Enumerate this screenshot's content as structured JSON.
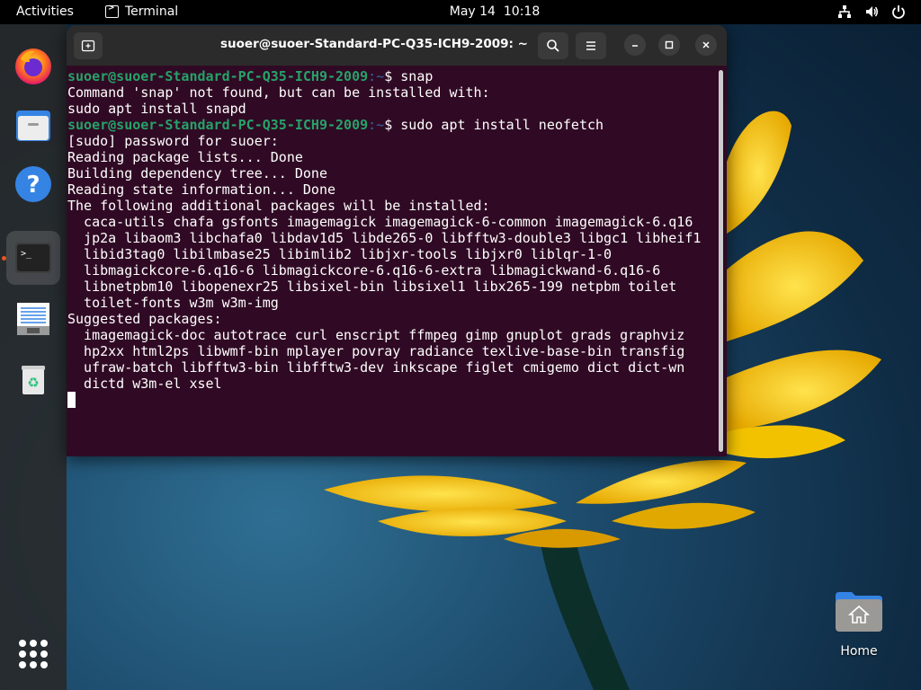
{
  "topbar": {
    "activities": "Activities",
    "app_name": "Terminal",
    "date": "May 14",
    "time": "10:18",
    "status_icons": [
      "network-icon",
      "volume-icon",
      "power-icon"
    ]
  },
  "dock": {
    "items": [
      {
        "name": "Firefox",
        "icon": "firefox-icon"
      },
      {
        "name": "Files",
        "icon": "files-icon"
      },
      {
        "name": "Help",
        "icon": "help-icon"
      },
      {
        "name": "Terminal",
        "icon": "terminal-icon",
        "active": true
      },
      {
        "name": "Text Editor",
        "icon": "text-editor-icon"
      },
      {
        "name": "Trash",
        "icon": "trash-icon"
      }
    ],
    "show_apps_icon": "apps-grid-icon"
  },
  "window": {
    "title": "suoer@suoer-Standard-PC-Q35-ICH9-2009: ~",
    "buttons": [
      "new-tab",
      "search",
      "menu",
      "minimize",
      "maximize",
      "close"
    ]
  },
  "terminal": {
    "prompt_user": "suoer@suoer-Standard-PC-Q35-ICH9-2009",
    "prompt_path": ":~",
    "lines": [
      {
        "type": "prompt",
        "cmd": "$ snap"
      },
      {
        "type": "out",
        "text": "Command 'snap' not found, but can be installed with:"
      },
      {
        "type": "out",
        "text": "sudo apt install snapd"
      },
      {
        "type": "prompt",
        "cmd": "$ sudo apt install neofetch"
      },
      {
        "type": "out",
        "text": "[sudo] password for suoer:"
      },
      {
        "type": "out",
        "text": "Reading package lists... Done"
      },
      {
        "type": "out",
        "text": "Building dependency tree... Done"
      },
      {
        "type": "out",
        "text": "Reading state information... Done"
      },
      {
        "type": "out",
        "text": "The following additional packages will be installed:"
      },
      {
        "type": "out",
        "text": "  caca-utils chafa gsfonts imagemagick imagemagick-6-common imagemagick-6.q16"
      },
      {
        "type": "out",
        "text": "  jp2a libaom3 libchafa0 libdav1d5 libde265-0 libfftw3-double3 libgc1 libheif1"
      },
      {
        "type": "out",
        "text": "  libid3tag0 libilmbase25 libimlib2 libjxr-tools libjxr0 liblqr-1-0"
      },
      {
        "type": "out",
        "text": "  libmagickcore-6.q16-6 libmagickcore-6.q16-6-extra libmagickwand-6.q16-6"
      },
      {
        "type": "out",
        "text": "  libnetpbm10 libopenexr25 libsixel-bin libsixel1 libx265-199 netpbm toilet"
      },
      {
        "type": "out",
        "text": "  toilet-fonts w3m w3m-img"
      },
      {
        "type": "out",
        "text": "Suggested packages:"
      },
      {
        "type": "out",
        "text": "  imagemagick-doc autotrace curl enscript ffmpeg gimp gnuplot grads graphviz"
      },
      {
        "type": "out",
        "text": "  hp2xx html2ps libwmf-bin mplayer povray radiance texlive-base-bin transfig"
      },
      {
        "type": "out",
        "text": "  ufraw-batch libfftw3-bin libfftw3-dev inkscape figlet cmigemo dict dict-wn"
      },
      {
        "type": "out",
        "text": "  dictd w3m-el xsel"
      },
      {
        "type": "cursor"
      }
    ]
  },
  "desktop": {
    "home_label": "Home"
  },
  "colors": {
    "terminal_bg": "#300a24",
    "prompt_user": "#26a269",
    "prompt_path": "#3465a4",
    "titlebar_bg": "#2b2b2b",
    "dock_bg": "#282828",
    "accent": "#e95420"
  }
}
